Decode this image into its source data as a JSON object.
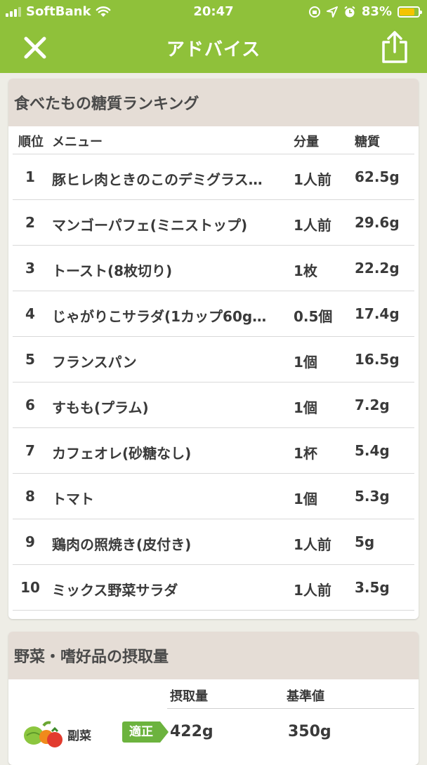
{
  "status": {
    "carrier": "SoftBank",
    "time": "20:47",
    "battery": "83%",
    "battery_level": 0.83
  },
  "nav": {
    "title": "アドバイス",
    "close_icon": "close-icon",
    "share_icon": "share-icon"
  },
  "ranking": {
    "title": "食べたもの糖質ランキング",
    "headers": {
      "rank": "順位",
      "menu": "メニュー",
      "qty": "分量",
      "sugar": "糖質"
    },
    "rows": [
      {
        "rank": "1",
        "name": "豚ヒレ肉ときのこのデミグラス…",
        "qty": "1人前",
        "sugar": "62.5g"
      },
      {
        "rank": "2",
        "name": "マンゴーパフェ(ミニストップ)",
        "qty": "1人前",
        "sugar": "29.6g"
      },
      {
        "rank": "3",
        "name": "トースト(8枚切り)",
        "qty": "1枚",
        "sugar": "22.2g"
      },
      {
        "rank": "4",
        "name": "じゃがりこサラダ(1カップ60g…",
        "qty": "0.5個",
        "sugar": "17.4g"
      },
      {
        "rank": "5",
        "name": "フランスパン",
        "qty": "1個",
        "sugar": "16.5g"
      },
      {
        "rank": "6",
        "name": "すもも(プラム)",
        "qty": "1個",
        "sugar": "7.2g"
      },
      {
        "rank": "7",
        "name": "カフェオレ(砂糖なし)",
        "qty": "1杯",
        "sugar": "5.4g"
      },
      {
        "rank": "8",
        "name": "トマト",
        "qty": "1個",
        "sugar": "5.3g"
      },
      {
        "rank": "9",
        "name": "鶏肉の照焼き(皮付き)",
        "qty": "1人前",
        "sugar": "5g"
      },
      {
        "rank": "10",
        "name": "ミックス野菜サラダ",
        "qty": "1人前",
        "sugar": "3.5g"
      }
    ]
  },
  "vegetables": {
    "title": "野菜・嗜好品の摂取量",
    "headers": {
      "intake": "摂取量",
      "standard": "基準値"
    },
    "rows": [
      {
        "icon": "vegetables-icon",
        "label": "副菜",
        "badge": "適正",
        "intake": "422g",
        "standard": "350g"
      }
    ]
  },
  "colors": {
    "header_green": "#8fc13a",
    "badge_green": "#6cb33e",
    "card_header": "#e5ddd6",
    "background": "#eeede6"
  }
}
